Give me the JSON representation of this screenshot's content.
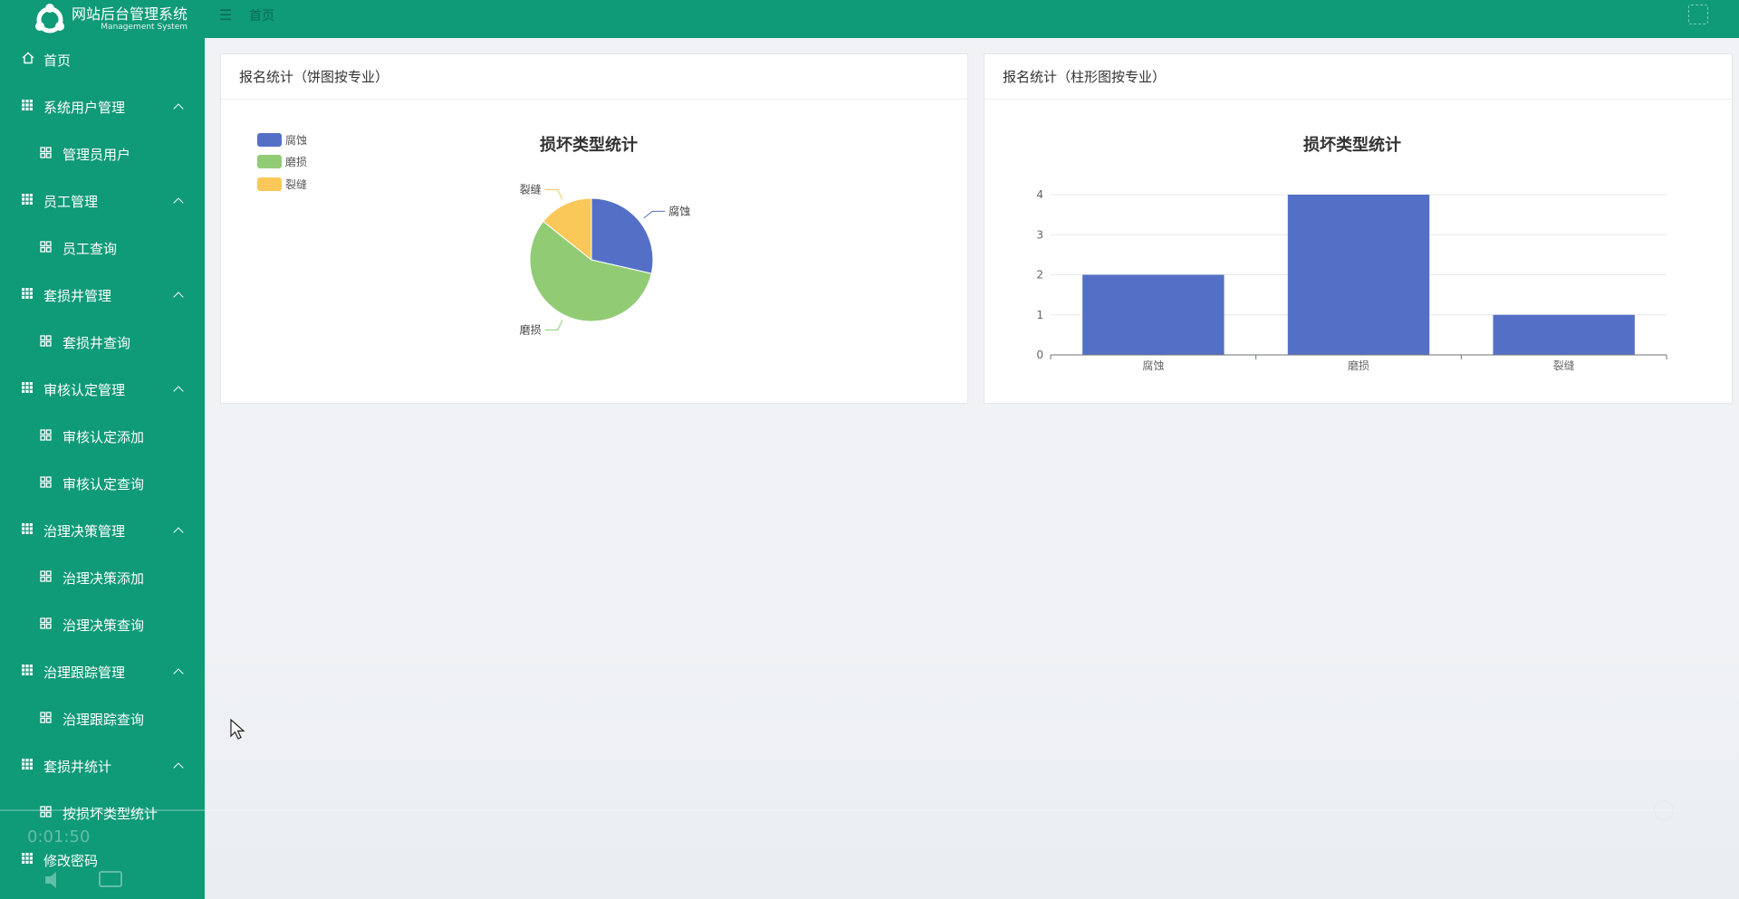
{
  "app": {
    "title": "网站后台管理系统",
    "subtitle": "Management System"
  },
  "header": {
    "breadcrumb": "首页"
  },
  "sidebar": {
    "items": [
      {
        "label": "首页",
        "icon": "home-icon",
        "kind": "top"
      },
      {
        "label": "系统用户管理",
        "icon": "grid-icon",
        "kind": "group"
      },
      {
        "label": "管理员用户",
        "icon": "apps-icon",
        "kind": "sub"
      },
      {
        "label": "员工管理",
        "icon": "grid-icon",
        "kind": "group"
      },
      {
        "label": "员工查询",
        "icon": "apps-icon",
        "kind": "sub"
      },
      {
        "label": "套损井管理",
        "icon": "grid-icon",
        "kind": "group"
      },
      {
        "label": "套损井查询",
        "icon": "apps-icon",
        "kind": "sub"
      },
      {
        "label": "审核认定管理",
        "icon": "grid-icon",
        "kind": "group"
      },
      {
        "label": "审核认定添加",
        "icon": "apps-icon",
        "kind": "sub"
      },
      {
        "label": "审核认定查询",
        "icon": "apps-icon",
        "kind": "sub"
      },
      {
        "label": "治理决策管理",
        "icon": "grid-icon",
        "kind": "group"
      },
      {
        "label": "治理决策添加",
        "icon": "apps-icon",
        "kind": "sub"
      },
      {
        "label": "治理决策查询",
        "icon": "apps-icon",
        "kind": "sub"
      },
      {
        "label": "治理跟踪管理",
        "icon": "grid-icon",
        "kind": "group"
      },
      {
        "label": "治理跟踪查询",
        "icon": "apps-icon",
        "kind": "sub"
      },
      {
        "label": "套损井统计",
        "icon": "grid-icon",
        "kind": "group"
      },
      {
        "label": "按损坏类型统计",
        "icon": "apps-icon",
        "kind": "sub"
      },
      {
        "label": "修改密码",
        "icon": "grid-icon",
        "kind": "top"
      }
    ]
  },
  "panels": {
    "left_title": "报名统计（饼图按专业）",
    "right_title": "报名统计（柱形图按专业）"
  },
  "video": {
    "time": "0:01:50"
  },
  "colors": {
    "primary": "#0f9a78",
    "series_blue": "#5470c6",
    "series_green": "#91cc75",
    "series_yellow": "#fac858"
  },
  "chart_data": [
    {
      "type": "pie",
      "title": "损坏类型统计",
      "legend_position": "top-left",
      "categories": [
        "腐蚀",
        "磨损",
        "裂缝"
      ],
      "values": [
        2,
        4,
        1
      ],
      "colors": [
        "#5470c6",
        "#91cc75",
        "#fac858"
      ]
    },
    {
      "type": "bar",
      "title": "损坏类型统计",
      "categories": [
        "腐蚀",
        "磨损",
        "裂缝"
      ],
      "values": [
        2,
        4,
        1
      ],
      "yticks": [
        "0",
        "1",
        "2",
        "3",
        "4"
      ],
      "ylim": [
        0,
        4
      ],
      "grid": true,
      "color": "#5470c6"
    }
  ]
}
